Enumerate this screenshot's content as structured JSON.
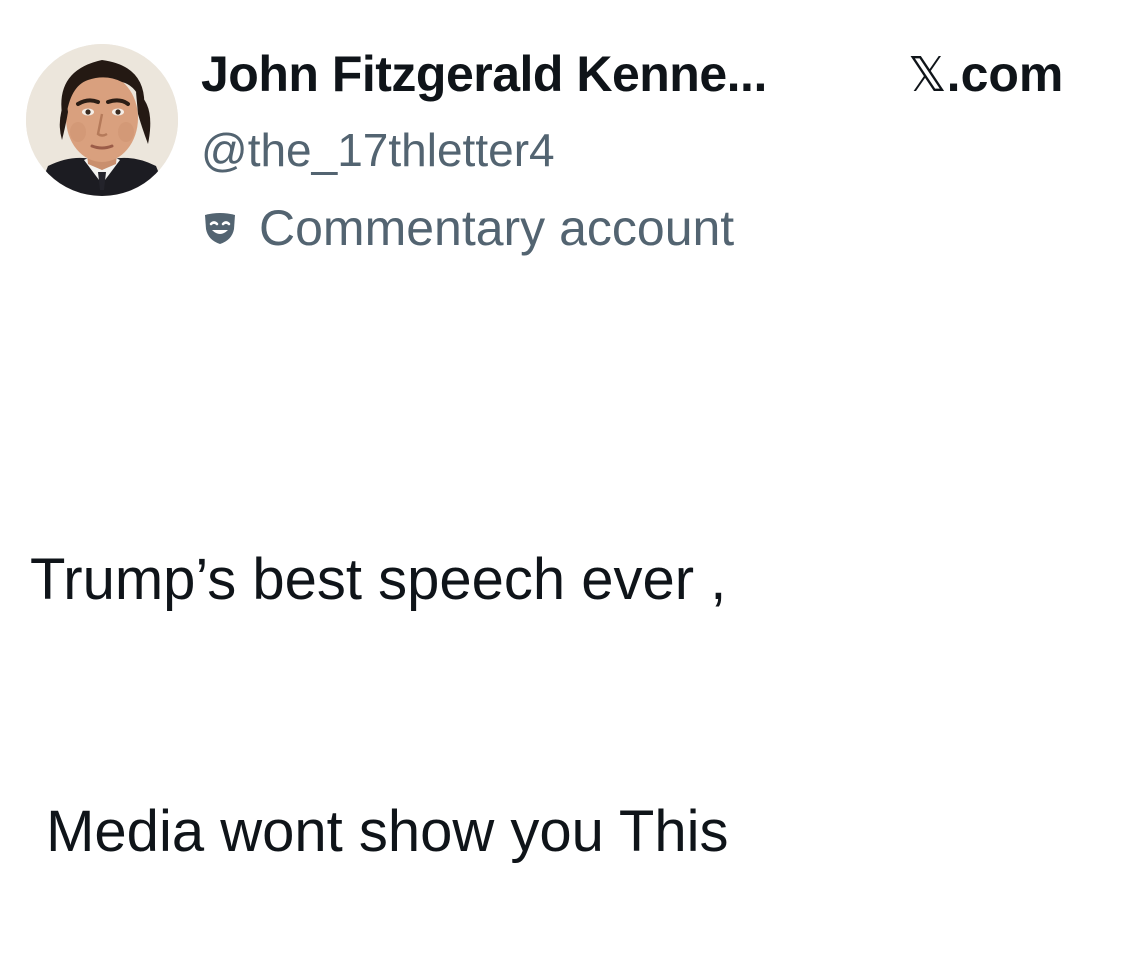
{
  "author": {
    "display_name": "John Fitzgerald Kenne...",
    "handle": "@the_17thletter4",
    "label": "Commentary account",
    "label_icon": "commentary-mask-icon"
  },
  "source": {
    "glyph": "𝕏",
    "suffix": ".com"
  },
  "post": {
    "line1": "Trump’s best speech ever ,",
    "line2": " Media wont show you This"
  },
  "colors": {
    "text_primary": "#0f1419",
    "text_secondary": "#536471",
    "background": "#ffffff"
  }
}
